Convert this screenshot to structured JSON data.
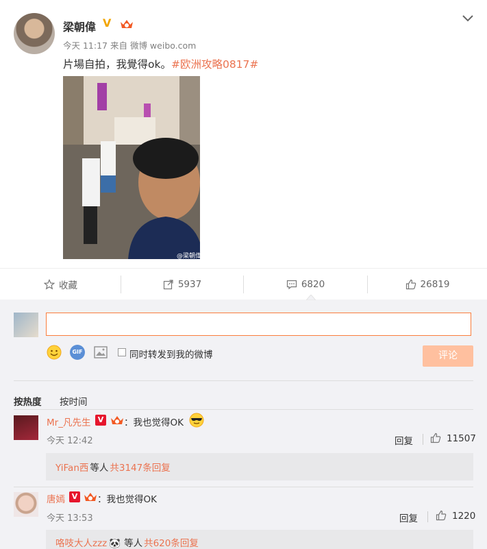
{
  "post": {
    "author": "梁朝偉",
    "verified_badge": "V",
    "time": "今天 11:17",
    "source": "来自 微博 weibo.com",
    "text": "片場自拍，我覺得ok。",
    "hashtag": "#欧洲攻略0817#",
    "watermark": "@梁朝偉"
  },
  "actions": {
    "favorite_label": "收藏",
    "repost_count": "5937",
    "comment_count": "6820",
    "like_count": "26819"
  },
  "composer": {
    "input_value": "",
    "gif_label": "GIF",
    "share_label": "同时转发到我的微博",
    "submit_label": "评论"
  },
  "sort": {
    "hot_label": "按热度",
    "time_label": "按时间"
  },
  "comments": [
    {
      "name": "Mr_凡先生",
      "badge": "V",
      "text": "：我也觉得OK",
      "time": "今天 12:42",
      "reply_label": "回复",
      "likes": "11507",
      "sub_user": "YiFan西",
      "sub_mid": "等人",
      "sub_count": "共3147条回复"
    },
    {
      "name": "唐嫣",
      "badge": "V",
      "text": "：我也觉得OK",
      "time": "今天 13:53",
      "reply_label": "回复",
      "likes": "1220",
      "sub_user": "咯吱大人zzz",
      "sub_mid": "等人",
      "sub_count": "共620条回复"
    }
  ],
  "colors": {
    "accent": "#eb7350",
    "input_border": "#fa7d3c",
    "submit_bg": "#ffc09f"
  }
}
